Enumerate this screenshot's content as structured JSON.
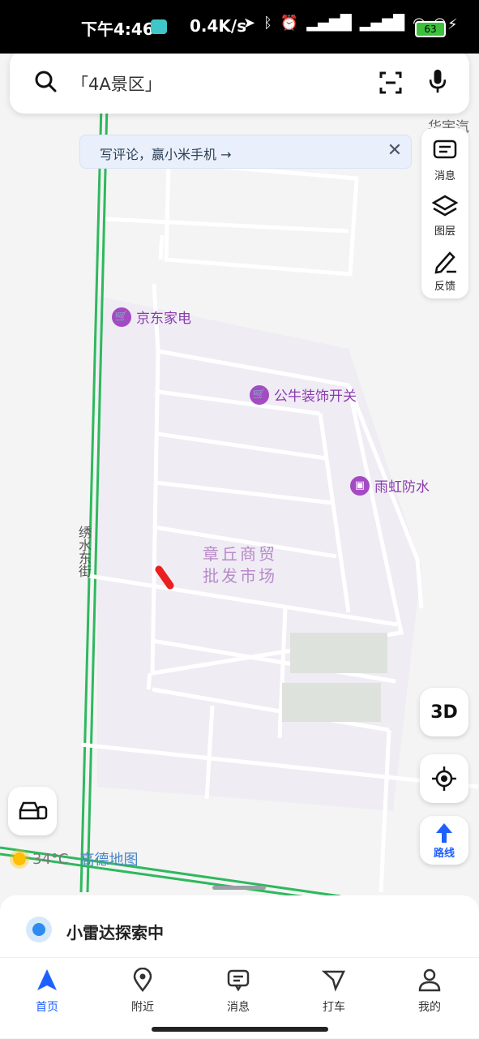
{
  "status_bar": {
    "time": "下午4:46",
    "net_speed": "0.4K/s",
    "battery": "63"
  },
  "search": {
    "placeholder": "「4A景区」"
  },
  "banner": {
    "text": "写评论，赢小米手机 →"
  },
  "side_toolbar": [
    {
      "label": "消息"
    },
    {
      "label": "图层"
    },
    {
      "label": "反馈"
    }
  ],
  "map": {
    "top_right_cut_label": "华宇汽",
    "pois": [
      {
        "label": "京东家电"
      },
      {
        "label": "公牛装饰开关"
      },
      {
        "label": "雨虹防水"
      }
    ],
    "area_label_line1": "章丘商贸",
    "area_label_line2": "批发市场",
    "street_label": "绣水东街"
  },
  "controls": {
    "btn_3d": "3D",
    "route_label": "路线"
  },
  "weather": {
    "temperature": "34°C",
    "brand": "高德地图"
  },
  "sheet": {
    "radar_text": "小雷达探索中"
  },
  "tabs": [
    {
      "label": "首页",
      "active": true
    },
    {
      "label": "附近",
      "active": false
    },
    {
      "label": "消息",
      "active": false
    },
    {
      "label": "打车",
      "active": false
    },
    {
      "label": "我的",
      "active": false
    }
  ]
}
